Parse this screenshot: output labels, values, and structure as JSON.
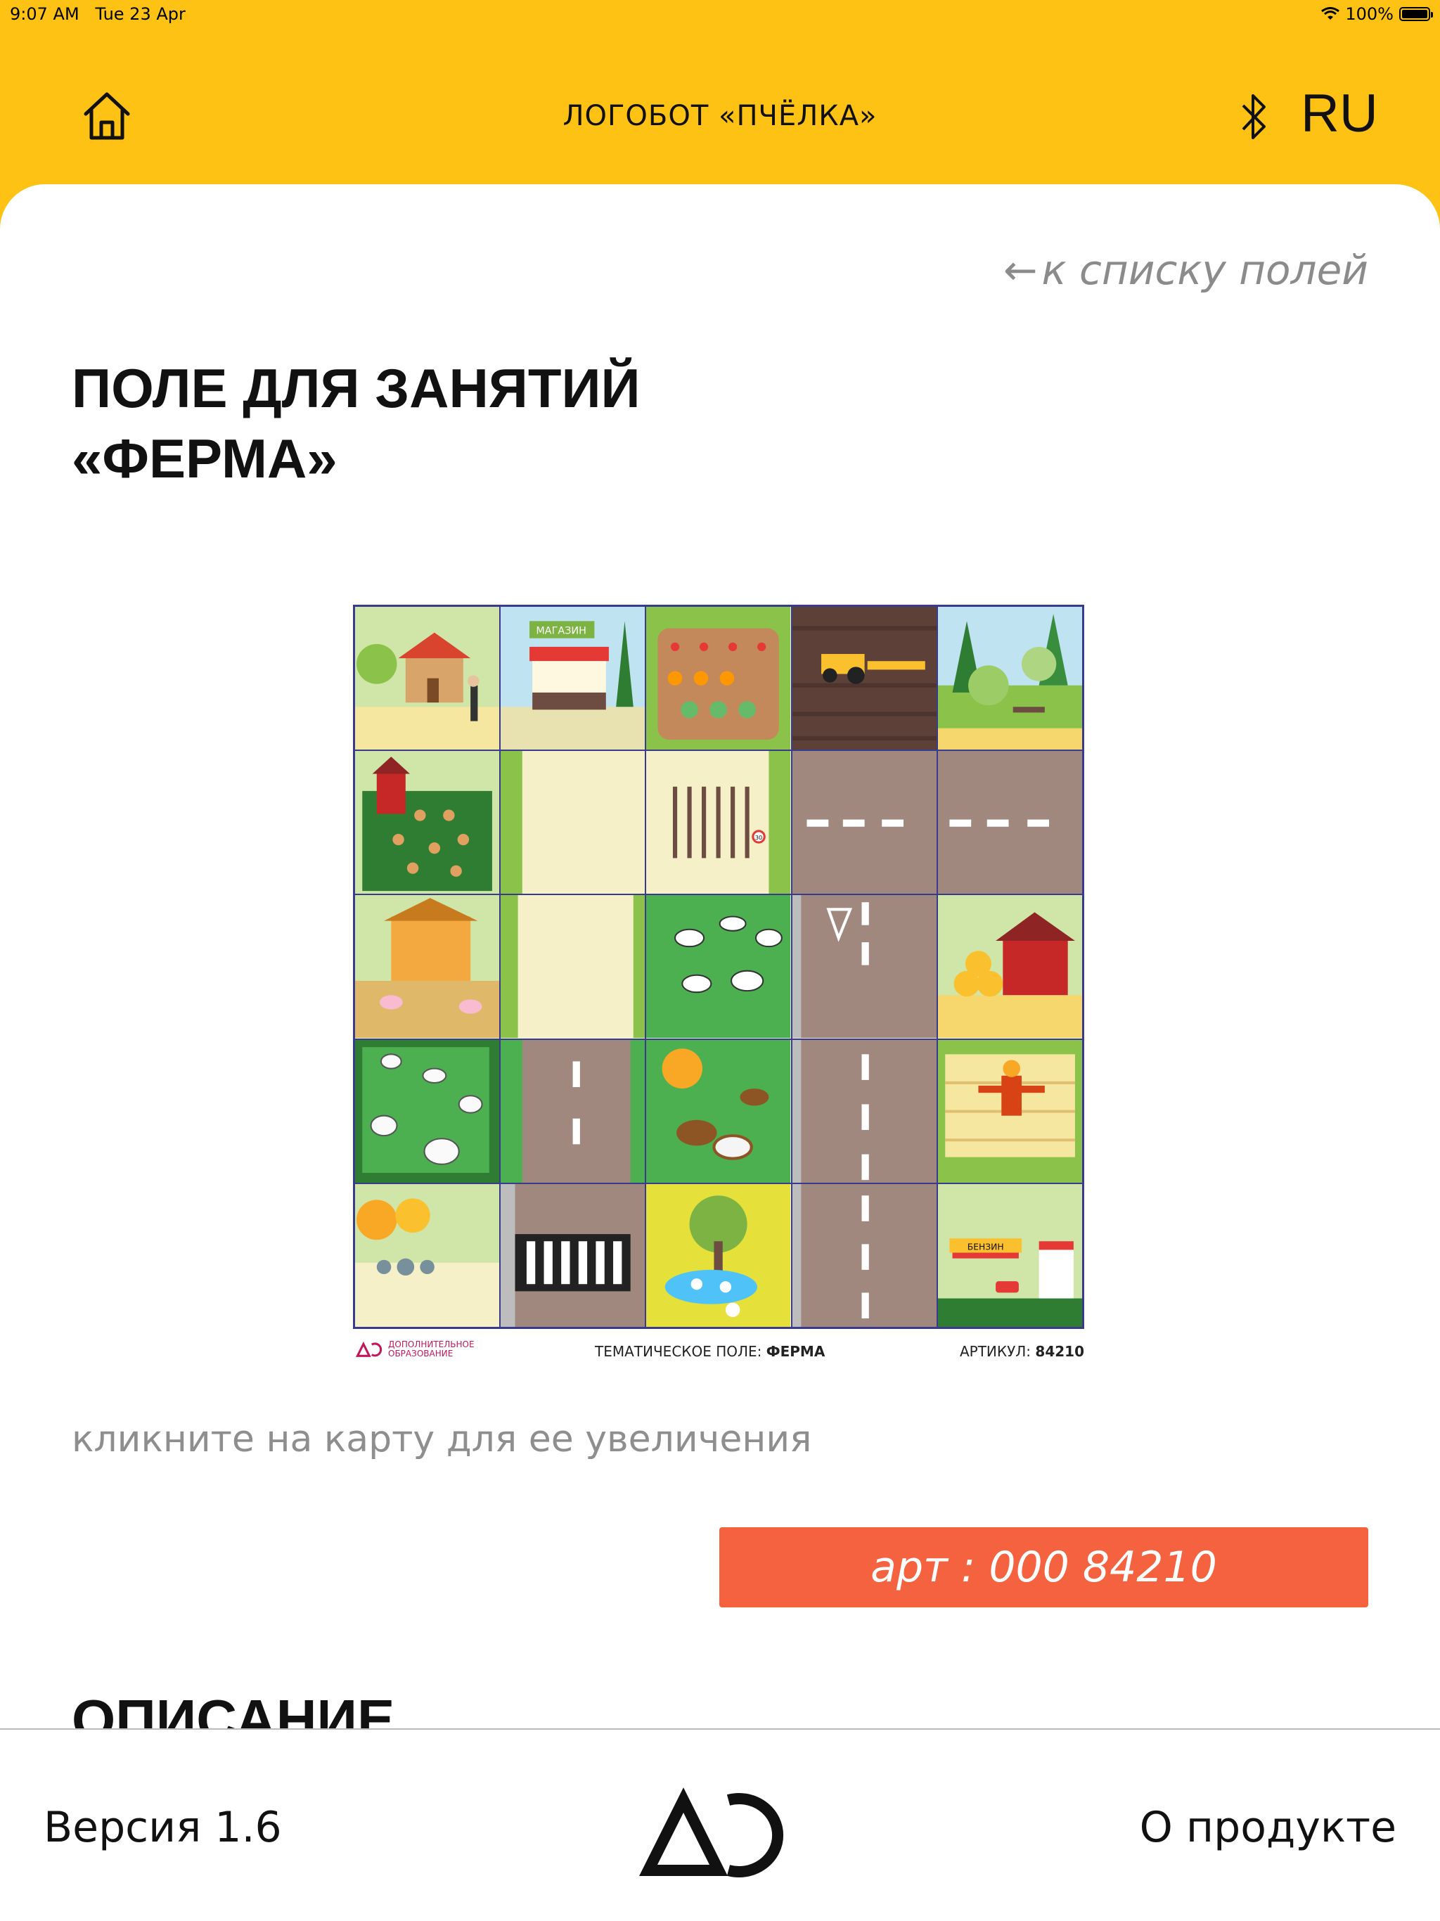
{
  "status_bar": {
    "time": "9:07 AM",
    "date": "Tue 23 Apr",
    "battery": "100%",
    "battery_level": 1.0
  },
  "header": {
    "home_icon": "home-icon",
    "title": "ЛОГОБОТ «ПЧЁЛКА»",
    "bluetooth_icon": "bluetooth-icon",
    "language": "RU"
  },
  "content": {
    "back_link": "к списку полей",
    "title_line1": "ПОЛЕ ДЛЯ ЗАНЯТИЙ",
    "title_line2": "«ФЕРМА»",
    "map": {
      "logo_text": "ДОПОЛНИТЕЛЬНОЕ ОБРАЗОВАНИЕ",
      "tile_labels": {
        "shop": "МАГАЗИН",
        "gas": "БЕНЗИН",
        "speed": "30"
      },
      "theme_prefix": "ТЕМАТИЧЕСКОЕ ПОЛЕ: ",
      "theme_value": "ФЕРМА",
      "article_prefix": "АРТИКУЛ: ",
      "article_value": "84210"
    },
    "hint": "кликните на карту для ее увеличения",
    "art_button": "арт : 000 84210",
    "description_title": "ОПИСАНИЕ"
  },
  "footer": {
    "version": "Версия 1.6",
    "about": "О продукте"
  },
  "colors": {
    "header_bg": "#FDC214",
    "button_bg": "#F5623F",
    "grid_line": "#3b3b8c"
  }
}
